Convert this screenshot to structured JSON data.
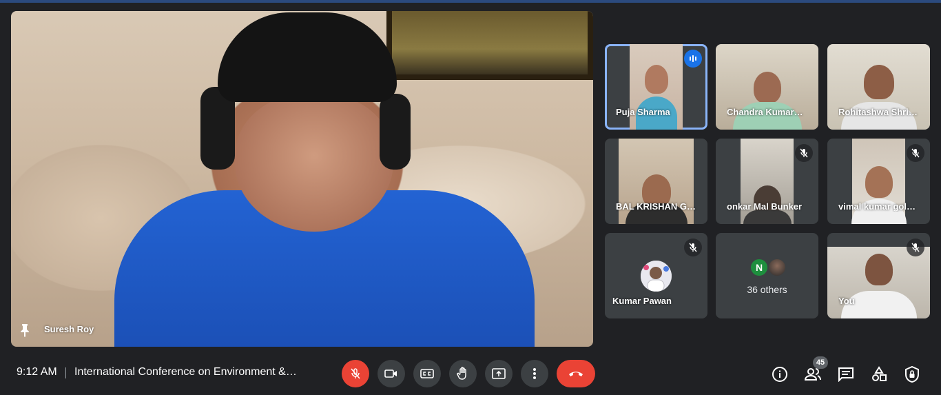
{
  "main_speaker": {
    "name": "Suresh Roy"
  },
  "participants": [
    {
      "name": "Puja Sharma",
      "state": "speaking"
    },
    {
      "name": "Chandra Kumar…",
      "state": "default"
    },
    {
      "name": "Rohitashwa Shri…",
      "state": "default"
    },
    {
      "name": "BAL KRISHAN G…",
      "state": "default"
    },
    {
      "name": "onkar Mal Bunker",
      "state": "muted"
    },
    {
      "name": "vimal kumar gol…",
      "state": "muted"
    },
    {
      "name": "Kumar Pawan",
      "state": "muted"
    },
    {
      "name": "You",
      "state": "muted"
    }
  ],
  "others": {
    "avatar_letter": "N",
    "label": "36 others"
  },
  "bottom_bar": {
    "time": "9:12 AM",
    "meeting_title": "International Conference on Environment &…",
    "participant_count": "45"
  },
  "colors": {
    "background": "#202124",
    "tile": "#3c4043",
    "danger": "#ea4335",
    "accent": "#1a73e8",
    "active_outline": "#8ab4f8"
  }
}
